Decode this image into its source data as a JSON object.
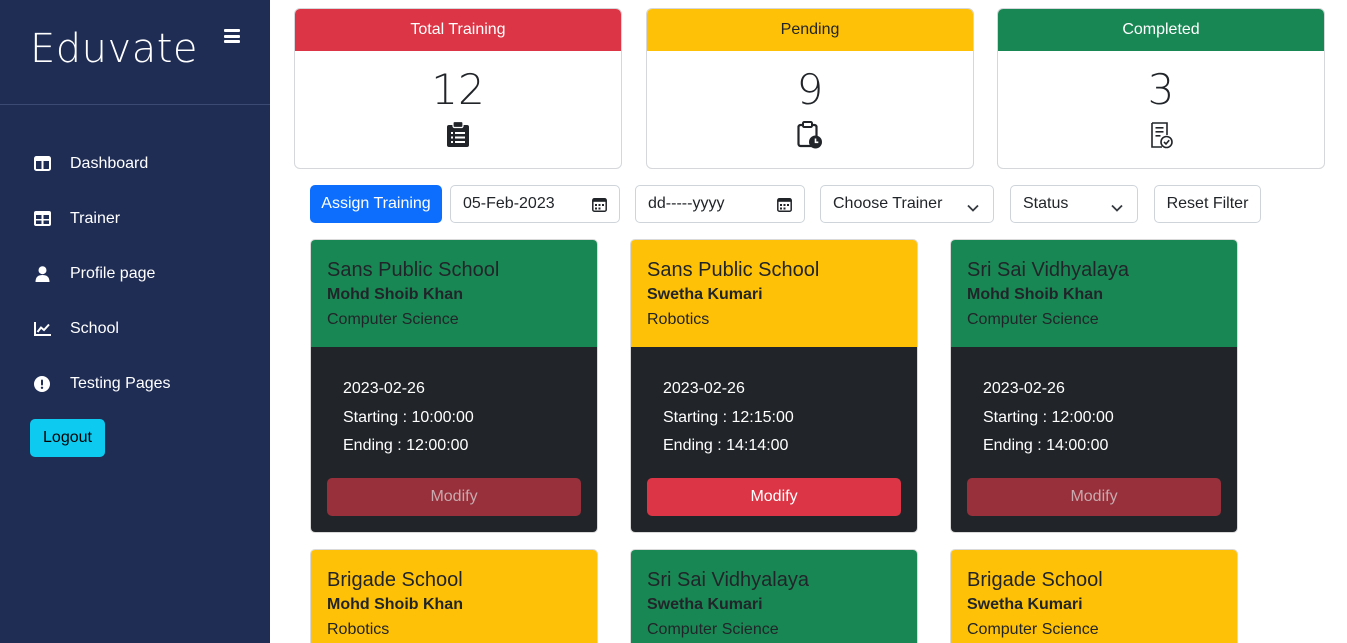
{
  "sidebar": {
    "brand": "Eduvate",
    "items": [
      {
        "label": "Dashboard",
        "icon": "layout-icon"
      },
      {
        "label": "Trainer",
        "icon": "table-icon"
      },
      {
        "label": "Profile page",
        "icon": "person-icon"
      },
      {
        "label": "School",
        "icon": "chart-line-icon"
      },
      {
        "label": "Testing Pages",
        "icon": "exclamation-circle-icon"
      }
    ],
    "logout_label": "Logout"
  },
  "stats": [
    {
      "label": "Total Training",
      "value": "12",
      "color": "#dc3545",
      "text_color": "#ffffff",
      "icon": "clipboard-list-icon"
    },
    {
      "label": "Pending",
      "value": "9",
      "color": "#ffc107",
      "text_color": "#212529",
      "icon": "clipboard-clock-icon"
    },
    {
      "label": "Completed",
      "value": "3",
      "color": "#198754",
      "text_color": "#ffffff",
      "icon": "clipboard-check-icon"
    }
  ],
  "filters": {
    "assign_label": "Assign Training",
    "date_from": "05-Feb-2023",
    "date_to": "dd-----yyyy",
    "trainer_select": "Choose Trainer",
    "status_select": "Status",
    "reset_label": "Reset Filter"
  },
  "trainings": [
    {
      "school": "Sans Public School",
      "trainer": "Mohd Shoib Khan",
      "subject": "Computer Science",
      "date": "2023-02-26",
      "starting": "Starting : 10:00:00",
      "ending": "Ending : 12:00:00",
      "status_color": "#198754",
      "modify": "Modify",
      "modify_enabled": false
    },
    {
      "school": "Sans Public School",
      "trainer": "Swetha Kumari",
      "subject": "Robotics",
      "date": "2023-02-26",
      "starting": "Starting : 12:15:00",
      "ending": "Ending : 14:14:00",
      "status_color": "#ffc107",
      "modify": "Modify",
      "modify_enabled": true
    },
    {
      "school": "Sri Sai Vidhyalaya",
      "trainer": "Mohd Shoib Khan",
      "subject": "Computer Science",
      "date": "2023-02-26",
      "starting": "Starting : 12:00:00",
      "ending": "Ending : 14:00:00",
      "status_color": "#198754",
      "modify": "Modify",
      "modify_enabled": false
    },
    {
      "school": "Brigade School",
      "trainer": "Mohd Shoib Khan",
      "subject": "Robotics",
      "status_color": "#ffc107"
    },
    {
      "school": "Sri Sai Vidhyalaya",
      "trainer": "Swetha Kumari",
      "subject": "Computer Science",
      "status_color": "#198754"
    },
    {
      "school": "Brigade School",
      "trainer": "Swetha Kumari",
      "subject": "Computer Science",
      "status_color": "#ffc107"
    }
  ]
}
